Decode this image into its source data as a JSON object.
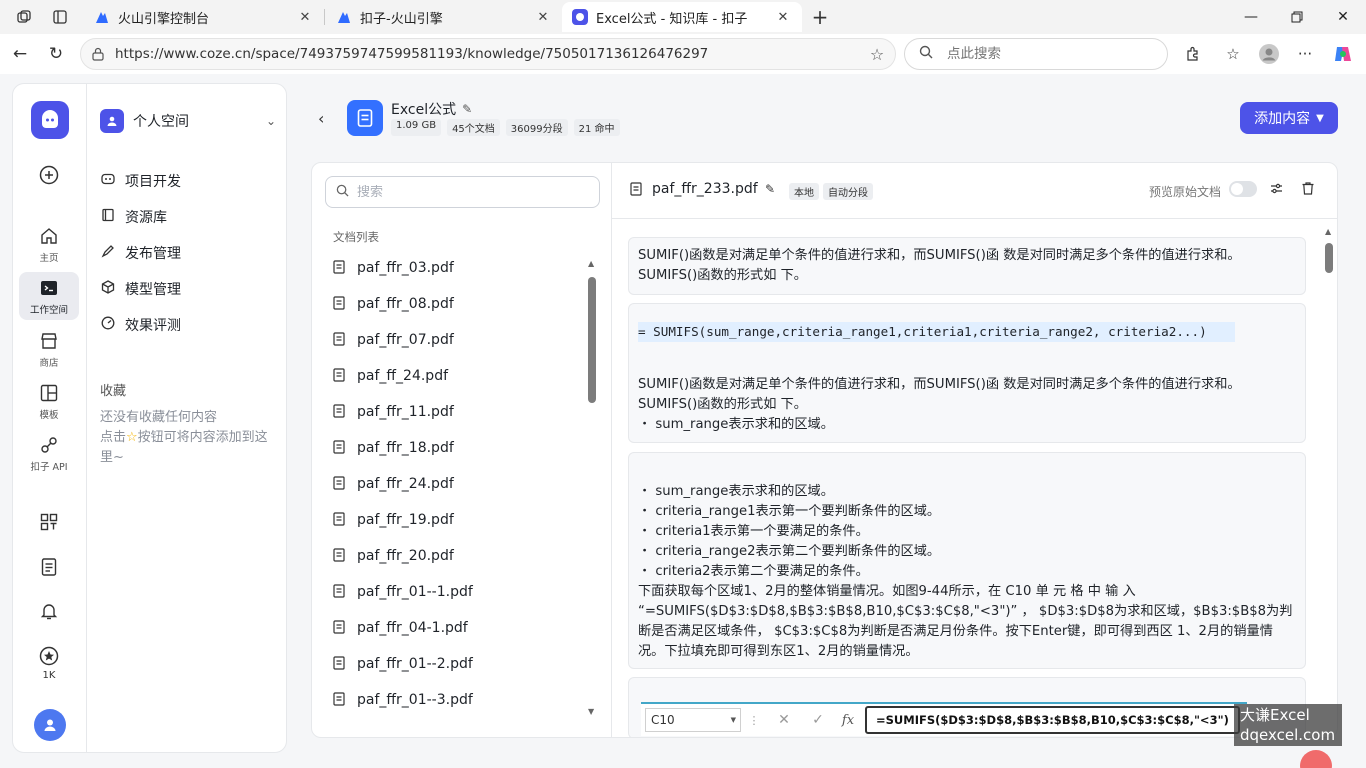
{
  "browser": {
    "tabs": [
      {
        "title": "火山引擎控制台",
        "active": false
      },
      {
        "title": "扣子-火山引擎",
        "active": false
      },
      {
        "title": "Excel公式 - 知识库 - 扣子",
        "active": true
      }
    ],
    "url": "https://www.coze.cn/space/7493759747599581193/knowledge/7505017136126476297",
    "search_placeholder": "点此搜索"
  },
  "rail": {
    "items": [
      {
        "icon": "home-icon",
        "label": "主页"
      },
      {
        "icon": "workspace-icon",
        "label": "工作空间"
      },
      {
        "icon": "store-icon",
        "label": "商店"
      },
      {
        "icon": "template-icon",
        "label": "模板"
      },
      {
        "icon": "api-icon",
        "label": "扣子 API"
      }
    ],
    "star_count": "1K"
  },
  "sidenav": {
    "space_name": "个人空间",
    "items": [
      {
        "icon": "project-icon",
        "label": "项目开发"
      },
      {
        "icon": "library-icon",
        "label": "资源库"
      },
      {
        "icon": "publish-icon",
        "label": "发布管理"
      },
      {
        "icon": "model-icon",
        "label": "模型管理"
      },
      {
        "icon": "evaluation-icon",
        "label": "效果评测"
      }
    ],
    "favorites_title": "收藏",
    "favorites_empty_1": "还没有收藏任何内容",
    "favorites_empty_2": "点击",
    "favorites_empty_3": "按钮可将内容添加到这里~"
  },
  "knowledge": {
    "title": "Excel公式",
    "tags": [
      "1.09 GB",
      "45个文档",
      "36099分段",
      "21 命中"
    ],
    "add_button": "添加内容"
  },
  "doc_list": {
    "search_placeholder": "搜索",
    "header": "文档列表",
    "files": [
      "paf_ffr_03.pdf",
      "paf_ffr_08.pdf",
      "paf_ffr_07.pdf",
      "paf_ff_24.pdf",
      "paf_ffr_11.pdf",
      "paf_ffr_18.pdf",
      "paf_ffr_24.pdf",
      "paf_ffr_19.pdf",
      "paf_ffr_20.pdf",
      "paf_ffr_01--1.pdf",
      "paf_ffr_04-1.pdf",
      "paf_ffr_01--2.pdf",
      "paf_ffr_01--3.pdf"
    ]
  },
  "doc_view": {
    "file_name": "paf_ffr_233.pdf",
    "tag_local": "本地",
    "tag_auto": "自动分段",
    "preview_label": "预览原始文档",
    "preview_on": false,
    "chunk1": "SUMIF()函数是对满足单个条件的值进行求和，而SUMIFS()函 数是对同时满足多个条件的值进行求和。SUMIFS()函数的形式如 下。",
    "chunk2_code": "= SUMIFS(sum_range,criteria_range1,criteria1,criteria_range2, criteria2...)",
    "chunk2_text": "SUMIF()函数是对满足单个条件的值进行求和，而SUMIFS()函 数是对同时满足多个条件的值进行求和。SUMIFS()函数的形式如 下。",
    "chunk2_bullet": "・ sum_range表示求和的区域。",
    "chunk3_bullets": [
      "・ sum_range表示求和的区域。",
      "・ criteria_range1表示第一个要判断条件的区域。",
      "・ criteria1表示第一个要满足的条件。",
      "・ criteria_range2表示第二个要判断条件的区域。",
      "・ criteria2表示第二个要满足的条件。"
    ],
    "chunk3_para": "下面获取每个区域1、2月的整体销量情况。如图9-44所示，在 C10 单 元 格 中 输 入 “=SUMIFS($D$3:$D$8,$B$3:$B$8,B10,$C$3:$C$8,\"<3\")” ， $D$3:$D$8为求和区域，$B$3:$B$8为判断是否满足区域条件， $C$3:$C$8为判断是否满足月份条件。按下Enter键，即可得到西区 1、2月的销量情况。下拉填充即可得到东区1、2月的销量情况。",
    "excel_cell": "C10",
    "excel_formula": "=SUMIFS($D$3:$D$8,$B$3:$B$8,B10,$C$3:$C$8,\"<3\")"
  },
  "watermark": {
    "line1": "大谦Excel",
    "line2": "dqexcel.com"
  },
  "colors": {
    "brand": "#4d53e8",
    "doc_icon": "#3370ff",
    "code_highlight": "#e1efff"
  }
}
